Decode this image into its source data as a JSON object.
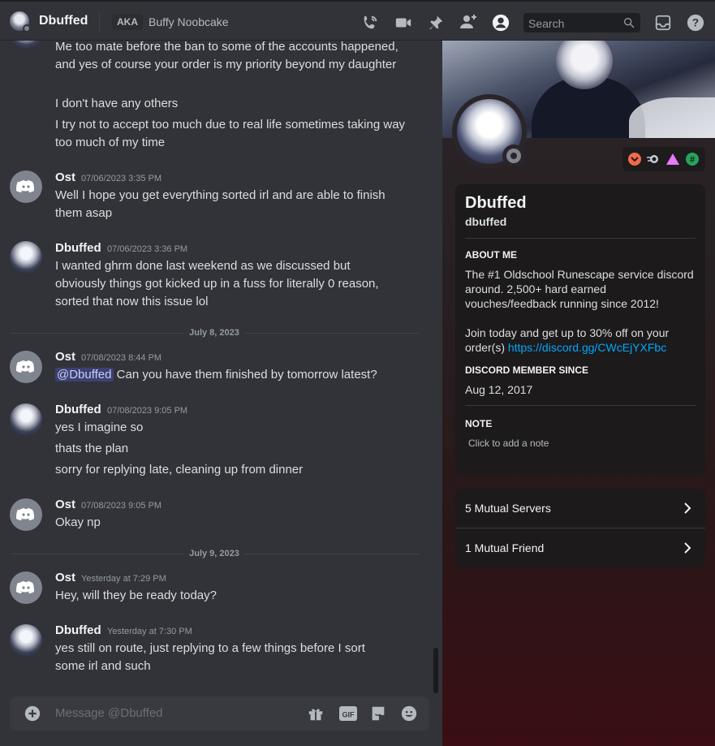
{
  "header": {
    "name": "Dbuffed",
    "aka_label": "AKA",
    "aka_name": "Buffy Noobcake",
    "search_placeholder": "Search"
  },
  "messages": [
    {
      "lines": [
        "Me too mate before the ban to some of the accounts happened, and yes of course your order is my priority beyond my daughter",
        "I don't have any others",
        "I try not to accept too much due to real life sometimes taking way too much of my time"
      ]
    },
    {
      "author": "Ost",
      "time": "07/06/2023 3:35 PM",
      "lines": [
        "Well I hope you get everything sorted irl and are able to finish them asap"
      ]
    },
    {
      "author": "Dbuffed",
      "time": "07/06/2023 3:36 PM",
      "lines": [
        "I wanted ghrm done last weekend as we discussed but obviously things got kicked up in a fuss for literally 0 reason, sorted that now this issue lol"
      ]
    },
    {
      "author": "Ost",
      "time": "07/08/2023 8:44 PM",
      "mention": "@Dbuffed",
      "lines": [
        "Can you have them finished by tomorrow latest?"
      ]
    },
    {
      "author": "Dbuffed",
      "time": "07/08/2023 9:05 PM",
      "lines": [
        "yes I imagine so",
        "thats the plan",
        "sorry for replying late, cleaning up from dinner"
      ]
    },
    {
      "author": "Ost",
      "time": "07/08/2023 9:05 PM",
      "lines": [
        "Okay np"
      ]
    },
    {
      "author": "Ost",
      "time": "Yesterday at 7:29 PM",
      "lines": [
        "Hey, will they be ready today?"
      ]
    },
    {
      "author": "Dbuffed",
      "time": "Yesterday at 7:30 PM",
      "lines": [
        "yes still on route, just replying to a few things before I sort some irl and such"
      ]
    }
  ],
  "date_separators": [
    "July 8, 2023",
    "July 9, 2023"
  ],
  "composer": {
    "placeholder": "Message @Dbuffed"
  },
  "profile": {
    "display_name": "Dbuffed",
    "username": "dbuffed",
    "about_title": "ABOUT ME",
    "about_text": "The #1 Oldschool Runescape service discord around. 2,500+ hard earned vouches/feedback running since 2012!",
    "about_join": "Join today and get up to 30% off on your order(s)",
    "about_link": "https://discord.gg/CWcEjYXFbc",
    "member_title": "DISCORD MEMBER SINCE",
    "member_since": "Aug 12, 2017",
    "note_title": "NOTE",
    "note_placeholder": "Click to add a note",
    "mutual_servers": "5 Mutual Servers",
    "mutual_friends": "1 Mutual Friend"
  },
  "colors": {
    "accent": "#5865f2",
    "link": "#00a8fc",
    "mention_bg": "#3c4270"
  }
}
